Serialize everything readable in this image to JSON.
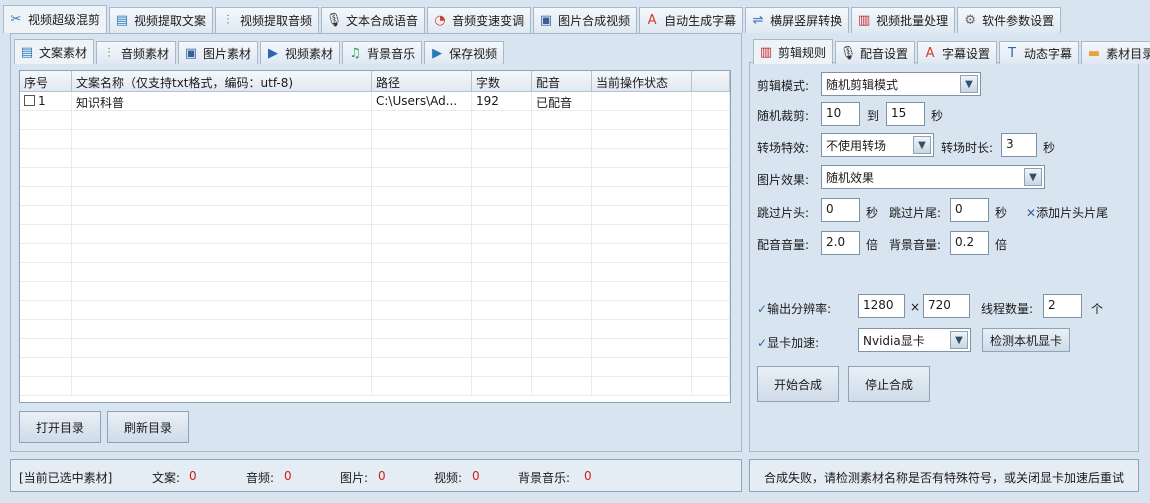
{
  "top_tabs": [
    {
      "label": "视频超级混剪",
      "icon": "scissors-icon",
      "glyph": "✂",
      "color": "#3b6fb6",
      "active": true
    },
    {
      "label": "视频提取文案",
      "icon": "document-icon",
      "glyph": "▤",
      "color": "#2b7ab8"
    },
    {
      "label": "视频提取音频",
      "icon": "audio-wave-icon",
      "glyph": "⫶",
      "color": "#29a24a"
    },
    {
      "label": "文本合成语音",
      "icon": "microphone-icon",
      "glyph": "🎙",
      "color": "#333333"
    },
    {
      "label": "音频变速变调",
      "icon": "speed-gauge-icon",
      "glyph": "◔",
      "color": "#d63a2a"
    },
    {
      "label": "图片合成视频",
      "icon": "image-icon",
      "glyph": "▣",
      "color": "#3a5f9a"
    },
    {
      "label": "自动生成字幕",
      "icon": "font-icon",
      "glyph": "A",
      "color": "#d63a2a"
    },
    {
      "label": "横屏竖屏转换",
      "icon": "rotate-screen-icon",
      "glyph": "⇌",
      "color": "#3b6fb6"
    },
    {
      "label": "视频批量处理",
      "icon": "film-icon",
      "glyph": "▥",
      "color": "#c0282a"
    },
    {
      "label": "软件参数设置",
      "icon": "gear-icon",
      "glyph": "⚙",
      "color": "#666666"
    }
  ],
  "left_tabs": [
    {
      "label": "文案素材",
      "icon": "document-icon",
      "glyph": "▤",
      "color": "#2b7ab8",
      "active": true
    },
    {
      "label": "音频素材",
      "icon": "audio-wave-icon",
      "glyph": "⫶",
      "color": "#29a24a"
    },
    {
      "label": "图片素材",
      "icon": "image-icon",
      "glyph": "▣",
      "color": "#3a5f9a"
    },
    {
      "label": "视频素材",
      "icon": "play-icon",
      "glyph": "▶",
      "color": "#2b62b8"
    },
    {
      "label": "背景音乐",
      "icon": "music-icon",
      "glyph": "♫",
      "color": "#29a24a"
    },
    {
      "label": "保存视频",
      "icon": "save-icon",
      "glyph": "▶",
      "color": "#2b7ab8"
    }
  ],
  "table": {
    "headers": [
      "序号",
      "文案名称（仅支持txt格式，编码：utf-8)",
      "路径",
      "字数",
      "配音",
      "当前操作状态",
      ""
    ],
    "rows": [
      {
        "index": "1",
        "name": "知识科普",
        "path": "C:\\Users\\Ad...",
        "count": "192",
        "voice": "已配音",
        "status": ""
      }
    ]
  },
  "left_buttons": {
    "open": "打开目录",
    "refresh": "刷新目录"
  },
  "right_tabs": [
    {
      "label": "剪辑规则",
      "icon": "film-icon",
      "glyph": "▥",
      "color": "#c0282a",
      "active": true
    },
    {
      "label": "配音设置",
      "icon": "microphone-icon",
      "glyph": "🎙",
      "color": "#333333"
    },
    {
      "label": "字幕设置",
      "icon": "font-icon",
      "glyph": "A",
      "color": "#d63a2a"
    },
    {
      "label": "动态字幕",
      "icon": "text-box-icon",
      "glyph": "T",
      "color": "#2b62b8"
    },
    {
      "label": "素材目录",
      "icon": "folder-icon",
      "glyph": "▬",
      "color": "#e8a33a"
    }
  ],
  "settings": {
    "edit_mode_label": "剪辑模式:",
    "edit_mode_value": "随机剪辑模式",
    "random_cut_label": "随机裁剪:",
    "random_cut_from": "10",
    "to_label": "到",
    "random_cut_to": "15",
    "seconds": "秒",
    "transition_label": "转场特效:",
    "transition_value": "不使用转场",
    "transition_duration_label": "转场时长:",
    "transition_duration_value": "3",
    "image_effect_label": "图片效果:",
    "image_effect_value": "随机效果",
    "skip_head_label": "跳过片头:",
    "skip_head_value": "0",
    "skip_tail_label": "跳过片尾:",
    "skip_tail_value": "0",
    "add_head_tail": "添加片头片尾",
    "voice_volume_label": "配音音量:",
    "voice_volume_value": "2.0",
    "times": "倍",
    "bg_volume_label": "背景音量:",
    "bg_volume_value": "0.2",
    "resolution_label": "输出分辨率:",
    "res_w": "1280",
    "res_x": "×",
    "res_h": "720",
    "threads_label": "线程数量:",
    "threads_value": "2",
    "threads_unit": "个",
    "gpu_label": "显卡加速:",
    "gpu_value": "Nvidia显卡",
    "detect_gpu": "检测本机显卡",
    "start": "开始合成",
    "stop": "停止合成"
  },
  "status": {
    "selected_label": "[当前已选中素材]",
    "text_label": "文案:",
    "text_count": "0",
    "audio_label": "音频:",
    "audio_count": "0",
    "image_label": "图片:",
    "image_count": "0",
    "video_label": "视频:",
    "video_count": "0",
    "bgm_label": "背景音乐:",
    "bgm_count": "0",
    "message": "合成失败，请检测素材名称是否有特殊符号，或关闭显卡加速后重试"
  }
}
